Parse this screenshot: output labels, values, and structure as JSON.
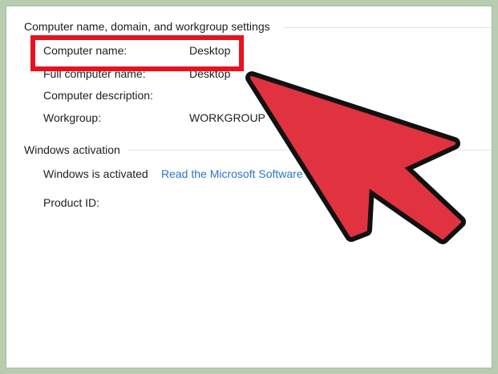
{
  "sections": {
    "computer": {
      "header": "Computer name, domain, and workgroup settings",
      "rows": [
        {
          "label": "Computer name:",
          "value": "Desktop"
        },
        {
          "label": "Full computer name:",
          "value": "Desktop"
        },
        {
          "label": "Computer description:",
          "value": ""
        },
        {
          "label": "Workgroup:",
          "value": "WORKGROUP"
        }
      ]
    },
    "activation": {
      "header": "Windows activation",
      "status_label": "Windows is activated",
      "link_text": "Read the Microsoft Software Li",
      "product_id_label": "Product ID:",
      "product_id_value": ""
    }
  },
  "annotation": {
    "highlight_color": "#e8121f",
    "arrow_color": "#e1323f",
    "arrow_outline_color": "#111111"
  },
  "colors": {
    "frame_background": "#b7ccb0",
    "link": "#2a74c5"
  }
}
